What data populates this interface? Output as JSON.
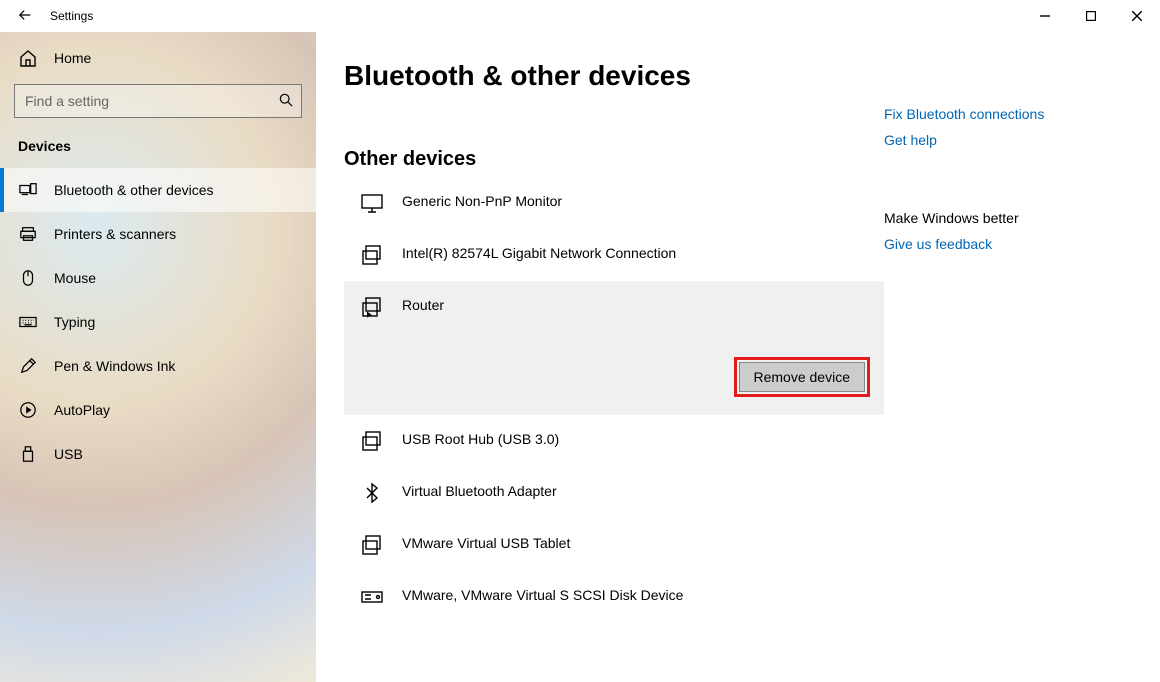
{
  "titlebar": {
    "title": "Settings"
  },
  "sidebar": {
    "home": "Home",
    "search_placeholder": "Find a setting",
    "group": "Devices",
    "items": [
      {
        "label": "Bluetooth & other devices"
      },
      {
        "label": "Printers & scanners"
      },
      {
        "label": "Mouse"
      },
      {
        "label": "Typing"
      },
      {
        "label": "Pen & Windows Ink"
      },
      {
        "label": "AutoPlay"
      },
      {
        "label": "USB"
      }
    ]
  },
  "main": {
    "title": "Bluetooth & other devices",
    "section": "Other devices",
    "devices": [
      {
        "label": "Generic Non-PnP Monitor"
      },
      {
        "label": "Intel(R) 82574L Gigabit Network Connection"
      },
      {
        "label": "Router",
        "selected": true,
        "remove_label": "Remove device"
      },
      {
        "label": "USB Root Hub (USB 3.0)"
      },
      {
        "label": "Virtual Bluetooth Adapter"
      },
      {
        "label": "VMware Virtual USB Tablet"
      },
      {
        "label": "VMware, VMware Virtual S SCSI Disk Device"
      }
    ]
  },
  "aside": {
    "link1": "Fix Bluetooth connections",
    "link2": "Get help",
    "better": "Make Windows better",
    "feedback": "Give us feedback"
  }
}
